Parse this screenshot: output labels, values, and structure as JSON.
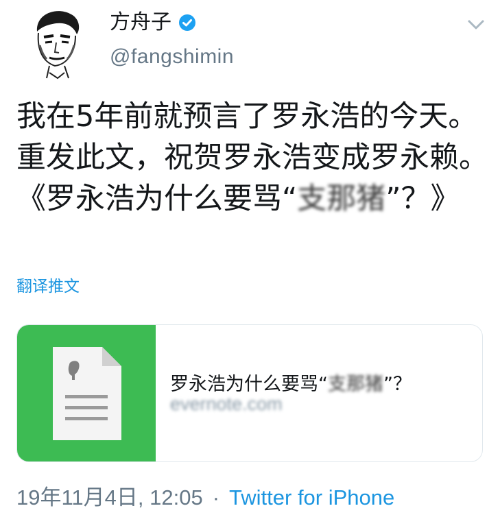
{
  "profile": {
    "display_name": "方舟子",
    "handle": "@fangshimin",
    "avatar_icon": "portrait-sketch-avatar",
    "verified_icon": "verified-badge-icon"
  },
  "menu": {
    "icon": "chevron-down-icon"
  },
  "tweet": {
    "text_main": "我在5年前就预言了罗永浩的今天。重发此文，祝贺罗永浩变成罗永赖。《罗永浩为什么要骂“",
    "text_blurred": "支那猪",
    "text_end": "”？》"
  },
  "translate_label": "翻译推文",
  "card": {
    "title_before": "罗永浩为什么要骂“",
    "title_blurred": "支那猪",
    "title_after": "”？",
    "domain": "evernote.com",
    "thumb_color": "#3dbb53",
    "thumb_icon": "evernote-document-icon"
  },
  "meta": {
    "timestamp": "19年11月4日, 12:05",
    "separator": "·",
    "source": "Twitter for iPhone"
  },
  "colors": {
    "accent": "#1b95e0",
    "secondary_text": "#657786"
  }
}
